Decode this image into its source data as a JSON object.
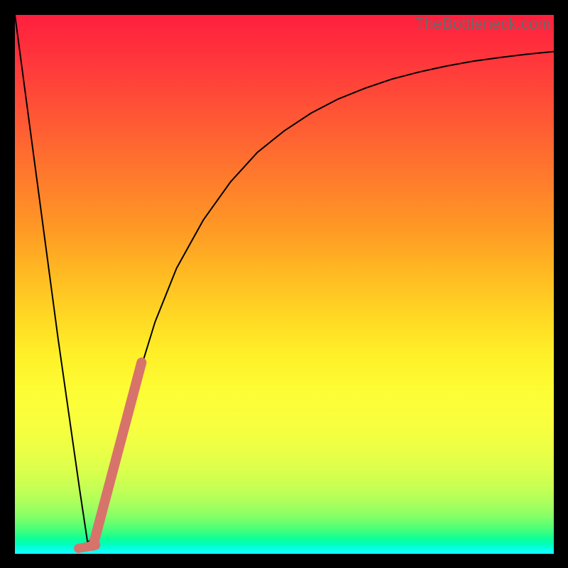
{
  "watermark": "TheBottleneck.com",
  "colors": {
    "curve_stroke": "#000000",
    "marker_fill": "#d8736c",
    "marker_stroke": "#d8736c"
  },
  "chart_data": {
    "type": "line",
    "title": "",
    "xlabel": "",
    "ylabel": "",
    "xlim": [
      0,
      100
    ],
    "ylim": [
      0,
      100
    ],
    "series": [
      {
        "name": "bottleneck-curve",
        "x": [
          0,
          4,
          8,
          12,
          13.5,
          15,
          18,
          22,
          26,
          30,
          35,
          40,
          45,
          50,
          55,
          60,
          65,
          70,
          75,
          80,
          85,
          90,
          95,
          100
        ],
        "values": [
          100,
          70,
          40,
          12,
          2,
          4,
          15,
          30,
          43,
          53,
          62,
          69,
          74.5,
          78.5,
          81.8,
          84.4,
          86.4,
          88.1,
          89.4,
          90.5,
          91.4,
          92.1,
          92.7,
          93.2
        ]
      }
    ],
    "markers": [
      {
        "name": "main-marker",
        "x0": 14.5,
        "y0": 1.5,
        "x1": 23.5,
        "y1": 35.5
      },
      {
        "name": "minor-marker",
        "x0": 11.8,
        "y0": 1.0,
        "x1": 15.0,
        "y1": 1.6
      }
    ]
  }
}
